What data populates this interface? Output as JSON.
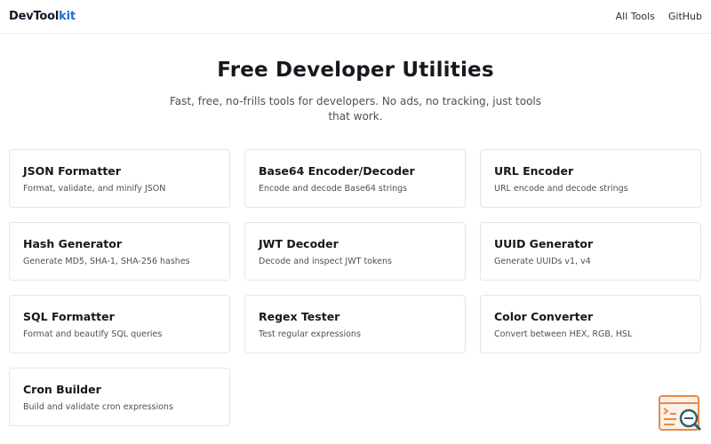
{
  "header": {
    "logo_main": "DevTool",
    "logo_accent": "kit",
    "nav": [
      {
        "label": "All Tools"
      },
      {
        "label": "GitHub"
      }
    ]
  },
  "hero": {
    "title": "Free Developer Utilities",
    "subtitle": "Fast, free, no-frills tools for developers. No ads, no tracking, just tools that work."
  },
  "tools": [
    {
      "title": "JSON Formatter",
      "desc": "Format, validate, and minify JSON"
    },
    {
      "title": "Base64 Encoder/Decoder",
      "desc": "Encode and decode Base64 strings"
    },
    {
      "title": "URL Encoder",
      "desc": "URL encode and decode strings"
    },
    {
      "title": "Hash Generator",
      "desc": "Generate MD5, SHA-1, SHA-256 hashes"
    },
    {
      "title": "JWT Decoder",
      "desc": "Decode and inspect JWT tokens"
    },
    {
      "title": "UUID Generator",
      "desc": "Generate UUIDs v1, v4"
    },
    {
      "title": "SQL Formatter",
      "desc": "Format and beautify SQL queries"
    },
    {
      "title": "Regex Tester",
      "desc": "Test regular expressions"
    },
    {
      "title": "Color Converter",
      "desc": "Convert between HEX, RGB, HSL"
    },
    {
      "title": "Cron Builder",
      "desc": "Build and validate cron expressions"
    }
  ],
  "colors": {
    "accent": "#1d6fd6",
    "badge_orange": "#e8894a",
    "badge_teal": "#2f5f6a"
  },
  "icons": {
    "floating_badge": "terminal-search-icon"
  }
}
